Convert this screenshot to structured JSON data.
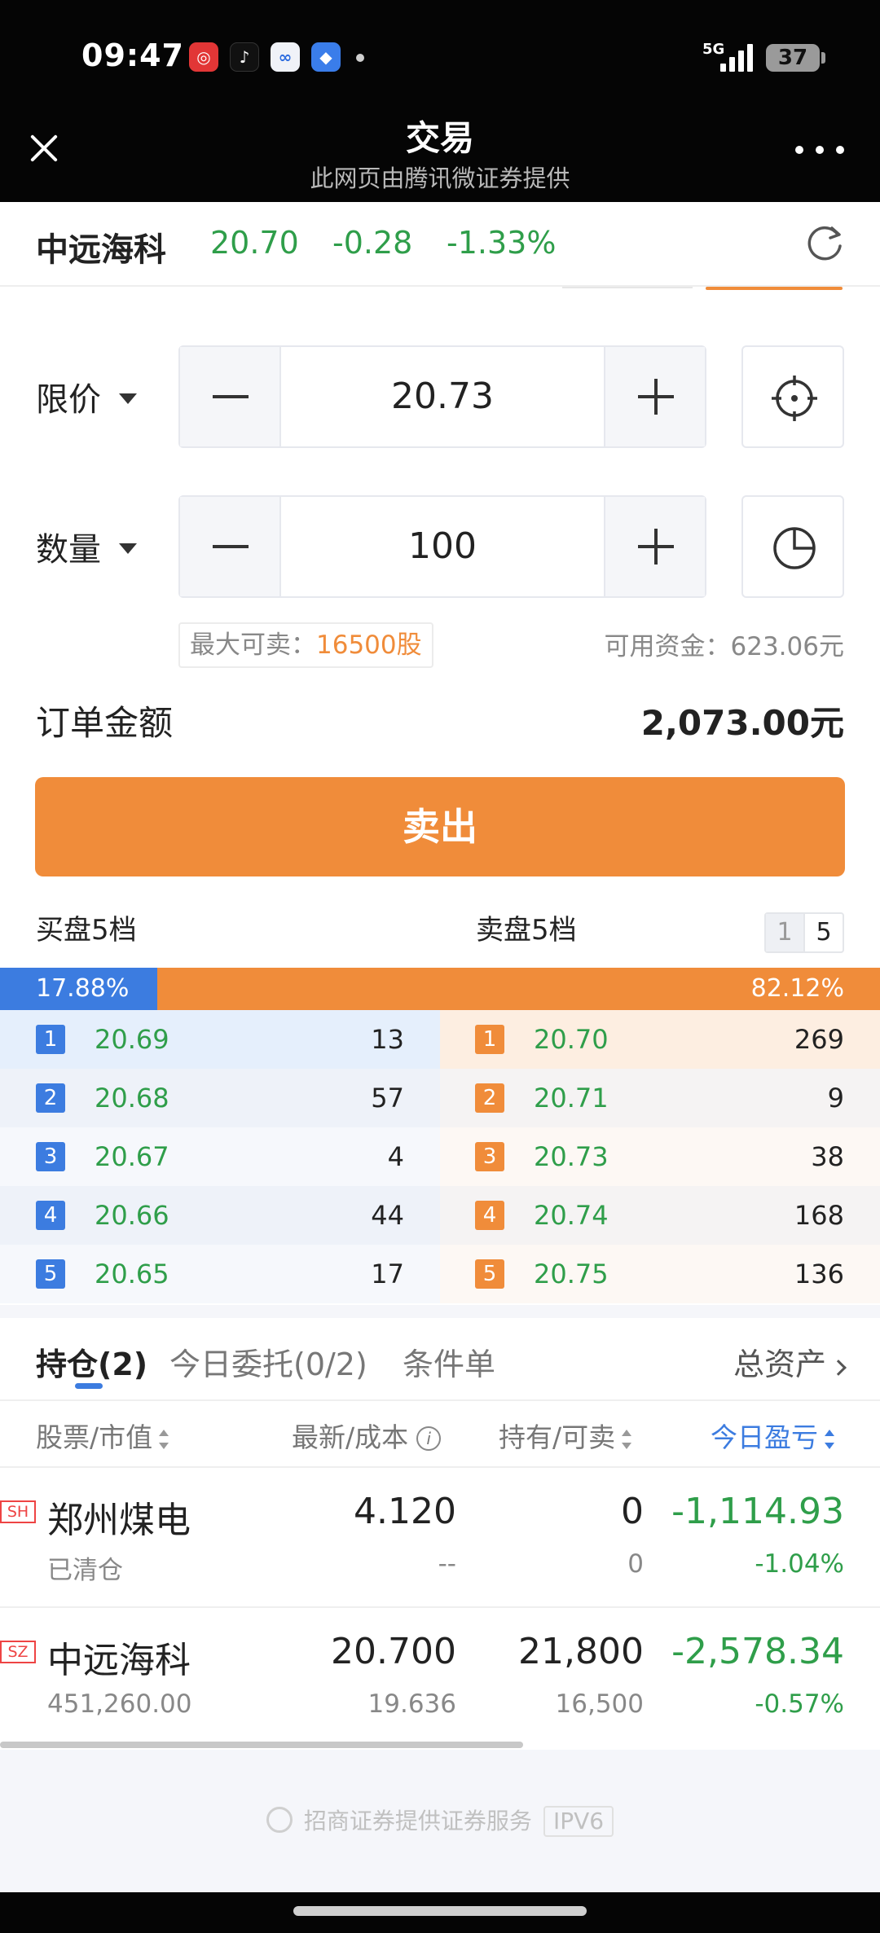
{
  "status_bar": {
    "time": "09:47",
    "network": "5G",
    "battery": "37",
    "app_icons": [
      "red-app-icon",
      "tiktok-icon",
      "blue-app-icon",
      "blue-square-app-icon"
    ]
  },
  "header": {
    "title": "交易",
    "subtitle": "此网页由腾讯微证券提供"
  },
  "quote": {
    "name": "中远海科",
    "price": "20.70",
    "change": "-0.28",
    "change_pct": "-1.33%"
  },
  "order": {
    "price_type": "限价",
    "price": "20.73",
    "qty_label": "数量",
    "quantity": "100",
    "max_sell_label": "最大可卖：",
    "max_sell_value": "16500股",
    "available_funds": "可用资金：623.06元",
    "amount_label": "订单金额",
    "amount_value": "2,073.00元",
    "sell_label": "卖出"
  },
  "depth": {
    "buy_title": "买盘5档",
    "sell_title": "卖盘5档",
    "switch": [
      "1",
      "5"
    ],
    "buy_ratio": "17.88%",
    "sell_ratio": "82.12%",
    "buy_ratio_value": 17.88,
    "bids": [
      {
        "level": "1",
        "price": "20.69",
        "volume": "13"
      },
      {
        "level": "2",
        "price": "20.68",
        "volume": "57"
      },
      {
        "level": "3",
        "price": "20.67",
        "volume": "4"
      },
      {
        "level": "4",
        "price": "20.66",
        "volume": "44"
      },
      {
        "level": "5",
        "price": "20.65",
        "volume": "17"
      }
    ],
    "asks": [
      {
        "level": "1",
        "price": "20.70",
        "volume": "269"
      },
      {
        "level": "2",
        "price": "20.71",
        "volume": "9"
      },
      {
        "level": "3",
        "price": "20.73",
        "volume": "38"
      },
      {
        "level": "4",
        "price": "20.74",
        "volume": "168"
      },
      {
        "level": "5",
        "price": "20.75",
        "volume": "136"
      }
    ]
  },
  "positions": {
    "tabs": [
      "持仓(2)",
      "今日委托(0/2)",
      "条件单"
    ],
    "total_assets": "总资产",
    "columns": [
      "股票/市值",
      "最新/成本",
      "持有/可卖",
      "今日盈亏"
    ],
    "rows": [
      {
        "market": "SH",
        "name": "郑州煤电",
        "sub": "已清仓",
        "latest": "4.120",
        "cost": "--",
        "hold": "0",
        "sellable": "0",
        "pnl": "-1,114.93",
        "pnl_pct": "-1.04%"
      },
      {
        "market": "SZ",
        "name": "中远海科",
        "sub": "451,260.00",
        "latest": "20.700",
        "cost": "19.636",
        "hold": "21,800",
        "sellable": "16,500",
        "pnl": "-2,578.34",
        "pnl_pct": "-0.57%"
      }
    ]
  },
  "footer": {
    "text": "招商证券提供证券服务",
    "tag": "IPV6"
  },
  "colors": {
    "accent_orange": "#f08c3a",
    "buy_blue": "#3c7ce0",
    "down_green": "#2f9e4a"
  }
}
